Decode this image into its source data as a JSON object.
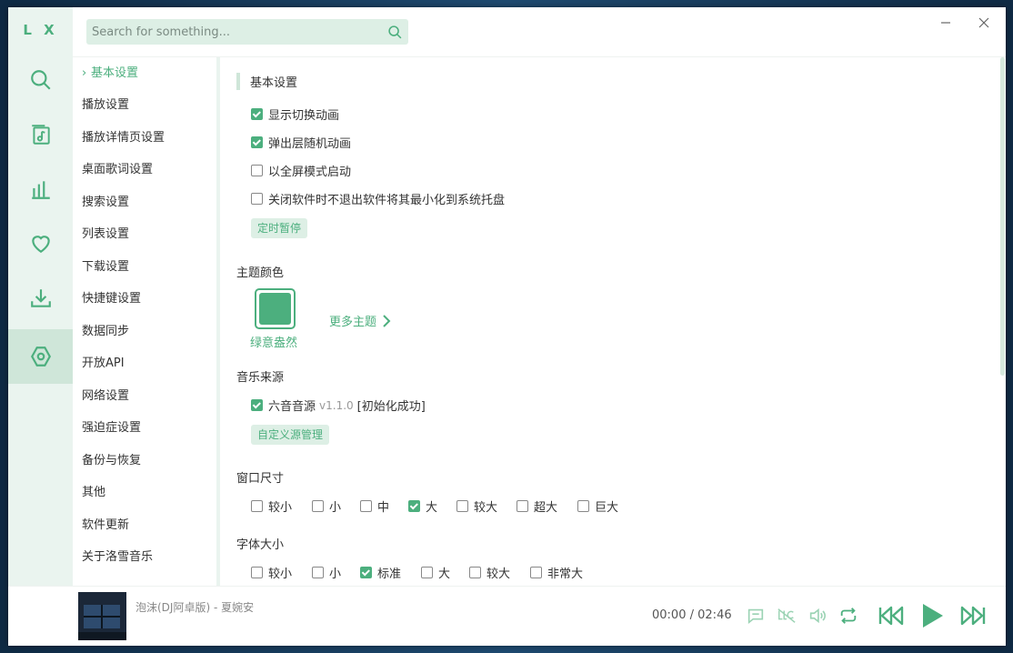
{
  "app": {
    "logo": "L X"
  },
  "search": {
    "placeholder": "Search for something..."
  },
  "nav": {
    "items": [
      {
        "label": "基本设置",
        "active": true
      },
      {
        "label": "播放设置"
      },
      {
        "label": "播放详情页设置"
      },
      {
        "label": "桌面歌词设置"
      },
      {
        "label": "搜索设置"
      },
      {
        "label": "列表设置"
      },
      {
        "label": "下载设置"
      },
      {
        "label": "快捷键设置"
      },
      {
        "label": "数据同步"
      },
      {
        "label": "开放API"
      },
      {
        "label": "网络设置"
      },
      {
        "label": "强迫症设置"
      },
      {
        "label": "备份与恢复"
      },
      {
        "label": "其他"
      },
      {
        "label": "软件更新"
      },
      {
        "label": "关于洛雪音乐"
      }
    ]
  },
  "basic": {
    "title": "基本设置",
    "options": [
      {
        "label": "显示切换动画",
        "checked": true
      },
      {
        "label": "弹出层随机动画",
        "checked": true
      },
      {
        "label": "以全屏模式启动",
        "checked": false
      },
      {
        "label": "关闭软件时不退出软件将其最小化到系统托盘",
        "checked": false
      }
    ],
    "timer_button": "定时暂停"
  },
  "theme": {
    "title": "主题颜色",
    "current_name": "绿意盎然",
    "current_color": "#4caf7e",
    "more_label": "更多主题"
  },
  "source": {
    "title": "音乐来源",
    "name": "六音音源",
    "version": "v1.1.0",
    "status": "[初始化成功]",
    "checked": true,
    "manage_button": "自定义源管理"
  },
  "window_size": {
    "title": "窗口尺寸",
    "options": [
      {
        "label": "较小",
        "checked": false
      },
      {
        "label": "小",
        "checked": false
      },
      {
        "label": "中",
        "checked": false
      },
      {
        "label": "大",
        "checked": true
      },
      {
        "label": "较大",
        "checked": false
      },
      {
        "label": "超大",
        "checked": false
      },
      {
        "label": "巨大",
        "checked": false
      }
    ]
  },
  "font_size": {
    "title": "字体大小",
    "options": [
      {
        "label": "较小",
        "checked": false
      },
      {
        "label": "小",
        "checked": false
      },
      {
        "label": "标准",
        "checked": true
      },
      {
        "label": "大",
        "checked": false
      },
      {
        "label": "较大",
        "checked": false
      },
      {
        "label": "非常大",
        "checked": false
      }
    ]
  },
  "player": {
    "song": "泡沫(DJ阿卓版) - 夏婉安",
    "current_time": "00:00",
    "separator": "/",
    "duration": "02:46"
  },
  "colors": {
    "accent": "#4caf7e",
    "accent_light": "#ddefe5",
    "rail_bg": "#eaf4ef"
  }
}
